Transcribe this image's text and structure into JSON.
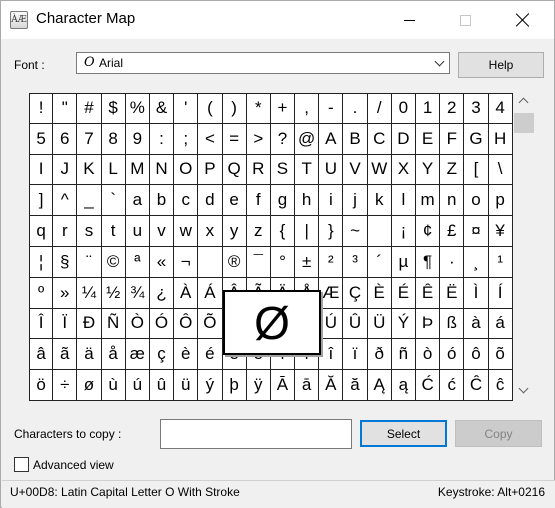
{
  "window": {
    "title": "Character Map",
    "icon_glyph": "ÀÆ"
  },
  "font": {
    "label": "Font :",
    "glyph": "O",
    "value": "Arial"
  },
  "buttons": {
    "help": "Help",
    "select": "Select",
    "copy": "Copy"
  },
  "grid": {
    "rows": [
      [
        "!",
        "\"",
        "#",
        "$",
        "%",
        "&",
        "'",
        "(",
        ")",
        "*",
        "+",
        ",",
        "-",
        ".",
        "/",
        "0",
        "1",
        "2",
        "3",
        "4"
      ],
      [
        "5",
        "6",
        "7",
        "8",
        "9",
        ":",
        ";",
        "<",
        "=",
        ">",
        "?",
        "@",
        "A",
        "B",
        "C",
        "D",
        "E",
        "F",
        "G",
        "H"
      ],
      [
        "I",
        "J",
        "K",
        "L",
        "M",
        "N",
        "O",
        "P",
        "Q",
        "R",
        "S",
        "T",
        "U",
        "V",
        "W",
        "X",
        "Y",
        "Z",
        "[",
        "\\"
      ],
      [
        "]",
        "^",
        "_",
        "`",
        "a",
        "b",
        "c",
        "d",
        "e",
        "f",
        "g",
        "h",
        "i",
        "j",
        "k",
        "l",
        "m",
        "n",
        "o",
        "p"
      ],
      [
        "q",
        "r",
        "s",
        "t",
        "u",
        "v",
        "w",
        "x",
        "y",
        "z",
        "{",
        "|",
        "}",
        "~",
        " ",
        "¡",
        "¢",
        "£",
        "¤",
        "¥"
      ],
      [
        "¦",
        "§",
        "¨",
        "©",
        "ª",
        "«",
        "¬",
        "­",
        "®",
        "¯",
        "°",
        "±",
        "²",
        "³",
        "´",
        "µ",
        "¶",
        "·",
        "¸",
        "¹"
      ],
      [
        "º",
        "»",
        "¼",
        "½",
        "¾",
        "¿",
        "À",
        "Á",
        "Â",
        "Ã",
        "Ä",
        "Å",
        "Æ",
        "Ç",
        "È",
        "É",
        "Ê",
        "Ë",
        "Ì",
        "Í"
      ],
      [
        "Î",
        "Ï",
        "Ð",
        "Ñ",
        "Ò",
        "Ó",
        "Ô",
        "Õ",
        "Ö",
        "×",
        "Ø",
        "Ù",
        "Ú",
        "Û",
        "Ü",
        "Ý",
        "Þ",
        "ß",
        "à",
        "á"
      ],
      [
        "â",
        "ã",
        "ä",
        "å",
        "æ",
        "ç",
        "è",
        "é",
        "ê",
        "ë",
        "ì",
        "í",
        "î",
        "ï",
        "ð",
        "ñ",
        "ò",
        "ó",
        "ô",
        "õ"
      ],
      [
        "ö",
        "÷",
        "ø",
        "ù",
        "ú",
        "û",
        "ü",
        "ý",
        "þ",
        "ÿ",
        "Ā",
        "ā",
        "Ă",
        "ă",
        "Ą",
        "ą",
        "Ć",
        "ć",
        "Ĉ",
        "ĉ"
      ]
    ],
    "selected_char": "Ø"
  },
  "copy": {
    "label": "Characters to copy :",
    "value": ""
  },
  "advanced": {
    "label": "Advanced view",
    "checked": false
  },
  "status": {
    "description": "U+00D8: Latin Capital Letter O With Stroke",
    "keystroke": "Keystroke: Alt+0216"
  }
}
